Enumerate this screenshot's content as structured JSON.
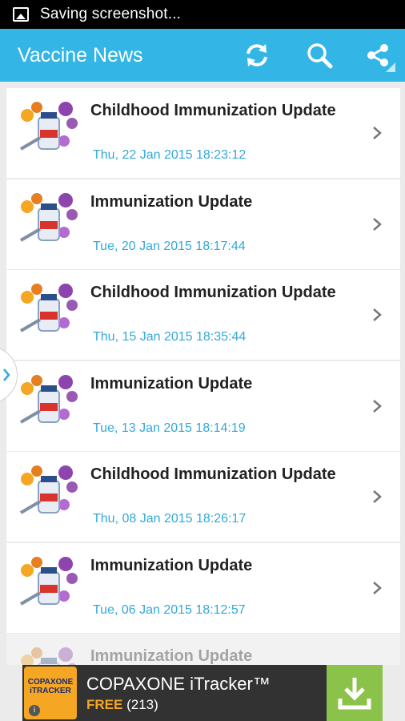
{
  "status_bar": {
    "text": "Saving screenshot..."
  },
  "app_bar": {
    "title": "Vaccine News",
    "actions": [
      "refresh-icon",
      "search-icon",
      "share-icon"
    ]
  },
  "news": [
    {
      "title": "Childhood Immunization Update",
      "date": "Thu, 22 Jan 2015 18:23:12"
    },
    {
      "title": "Immunization Update",
      "date": "Tue, 20 Jan 2015 18:17:44"
    },
    {
      "title": "Childhood Immunization Update",
      "date": "Thu, 15 Jan 2015 18:35:44"
    },
    {
      "title": "Immunization Update",
      "date": "Tue, 13 Jan 2015 18:14:19"
    },
    {
      "title": "Childhood Immunization Update",
      "date": "Thu, 08 Jan 2015 18:26:17"
    },
    {
      "title": "Immunization Update",
      "date": "Tue, 06 Jan 2015 18:12:57"
    },
    {
      "title": "Immunization Update",
      "date": ""
    }
  ],
  "ad": {
    "logo_text": "COPAXONE iTRACKER",
    "title": "COPAXONE iTracker™",
    "free_label": "FREE",
    "rating_count": "(213)"
  },
  "colors": {
    "accent": "#33b5e5",
    "date": "#33a9d9",
    "ad_download": "#8bc34a"
  }
}
